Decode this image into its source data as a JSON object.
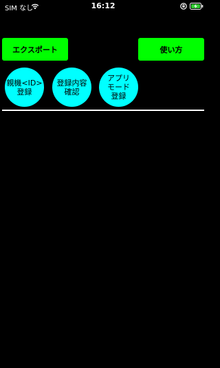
{
  "status_bar": {
    "carrier": "SIM なし",
    "time": "16:12"
  },
  "toolbar": {
    "export_label": "エクスポート",
    "usage_label": "使い方"
  },
  "menu": {
    "items": [
      {
        "label": "親機<ID>\n登録"
      },
      {
        "label": "登録内容\n確認"
      },
      {
        "label": "アプリ\nモード\n登録"
      }
    ]
  },
  "colors": {
    "background": "#000000",
    "action_button": "#00ff00",
    "circle_button": "#00ffff",
    "divider": "#ffffff"
  },
  "icons": [
    "wifi-icon",
    "lock-icon",
    "battery-charging-icon"
  ]
}
